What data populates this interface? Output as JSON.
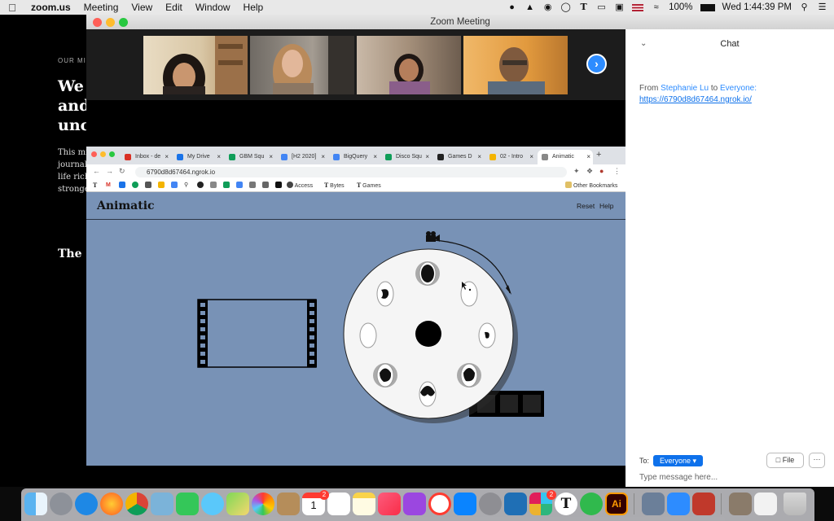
{
  "menubar": {
    "app_name": "zoom.us",
    "menus": [
      "Meeting",
      "View",
      "Edit",
      "Window",
      "Help"
    ],
    "battery": "100%",
    "clock": "Wed 1:44:39 PM",
    "flag_label": "US",
    "icons": [
      "camera-icon",
      "shield-icon",
      "eye-icon",
      "scan-icon",
      "nyt-icon",
      "airplay-icon",
      "display-icon",
      "flag-icon",
      "wifi-icon",
      "battery-icon",
      "search-icon",
      "list-icon"
    ]
  },
  "background_page": {
    "kicker": "OUR MI",
    "headline": "We\nand\nunc",
    "body": "This mi\njournal\nlife rich\nstronge",
    "logo": "The N"
  },
  "zoom": {
    "window_title": "Zoom Meeting",
    "participants": [
      "participant-1",
      "participant-2",
      "participant-3",
      "participant-4"
    ],
    "next_icon": "›"
  },
  "browser": {
    "tabs": [
      {
        "label": "Inbox - de",
        "color": "#d93025"
      },
      {
        "label": "My Drive",
        "color": "#1a73e8"
      },
      {
        "label": "GBM Squ",
        "color": "#0f9d58"
      },
      {
        "label": "[H2 2020]",
        "color": "#4285f4"
      },
      {
        "label": "BigQuery",
        "color": "#4285f4"
      },
      {
        "label": "Disco Squ",
        "color": "#0f9d58"
      },
      {
        "label": "Games D",
        "color": "#222222"
      },
      {
        "label": "02 - Intro",
        "color": "#f4b400"
      },
      {
        "label": "Animatic",
        "color": "#888888"
      }
    ],
    "url": "6790d8d67464.ngrok.io",
    "bookmarks": [
      "Access",
      "Bytes",
      "Games"
    ],
    "other_bookmarks": "Other Bookmarks",
    "app": {
      "title": "Animatic",
      "reset": "Reset",
      "help": "Help"
    }
  },
  "chat": {
    "title": "Chat",
    "from_prefix": "From",
    "sender": "Stephanie Lu",
    "to_word": "to",
    "recipient": "Everyone:",
    "link": "https://6790d8d67464.ngrok.io/",
    "to_label": "To:",
    "everyone_button": "Everyone ▾",
    "file_button": "File",
    "more_button": "···",
    "input_placeholder": "Type message here..."
  },
  "dock": {
    "apps": [
      "finder",
      "launchpad",
      "safari",
      "firefox",
      "chrome",
      "preview",
      "facetime",
      "messages",
      "maps",
      "photos",
      "notes-book",
      "calendar",
      "reminders",
      "notes",
      "music",
      "podcasts",
      "news",
      "app-store",
      "system-preferences",
      "cyberduck",
      "slack",
      "nyt",
      "lock",
      "illustrator",
      "photo-browser",
      "zoom",
      "photo-booth",
      "screenshot",
      "document",
      "trash"
    ],
    "calendar_day": "1",
    "badge": "2"
  }
}
